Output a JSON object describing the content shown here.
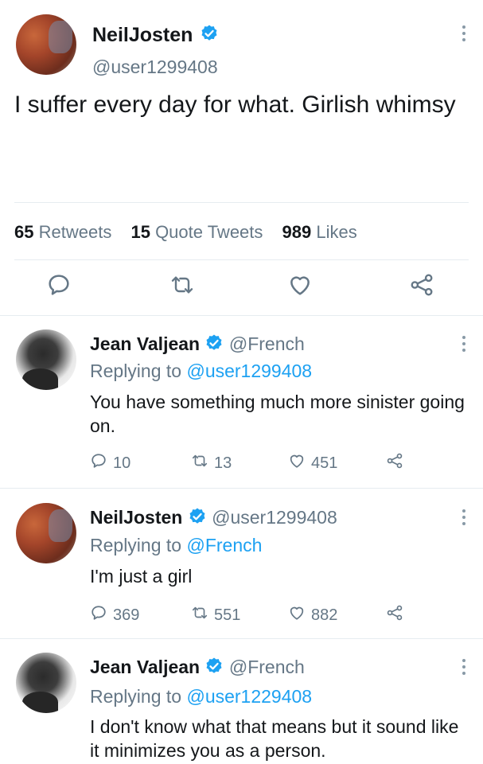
{
  "main_tweet": {
    "display_name": "NeilJosten",
    "handle": "@user1299408",
    "text": "I suffer every day for what. Girlish whimsy",
    "stats": {
      "retweets": {
        "count": "65",
        "label": "Retweets"
      },
      "quotes": {
        "count": "15",
        "label": "Quote Tweets"
      },
      "likes": {
        "count": "989",
        "label": "Likes"
      }
    }
  },
  "replies": [
    {
      "display_name": "Jean Valjean",
      "handle": "@French",
      "replying_prefix": "Replying to",
      "replying_to": "@user1299408",
      "text": "You have something much more sinister going on.",
      "counts": {
        "replies": "10",
        "retweets": "13",
        "likes": "451"
      }
    },
    {
      "display_name": "NeilJosten",
      "handle": "@user1299408",
      "replying_prefix": "Replying to",
      "replying_to": "@French",
      "text": "I'm just a girl",
      "counts": {
        "replies": "369",
        "retweets": "551",
        "likes": "882"
      }
    },
    {
      "display_name": "Jean Valjean",
      "handle": "@French",
      "replying_prefix": "Replying to",
      "replying_to": "@user1229408",
      "text": "I don't know what that means but it sound like it minimizes you as a person.",
      "counts": {}
    }
  ],
  "icons": {
    "verified": "verified-badge-icon",
    "more": "more-options-icon",
    "reply": "reply-icon",
    "retweet": "retweet-icon",
    "like": "heart-icon",
    "share": "share-icon"
  },
  "colors": {
    "accent": "#1da1f2",
    "text": "#14171a",
    "secondary": "#657786",
    "divider": "#e6ecf0"
  }
}
